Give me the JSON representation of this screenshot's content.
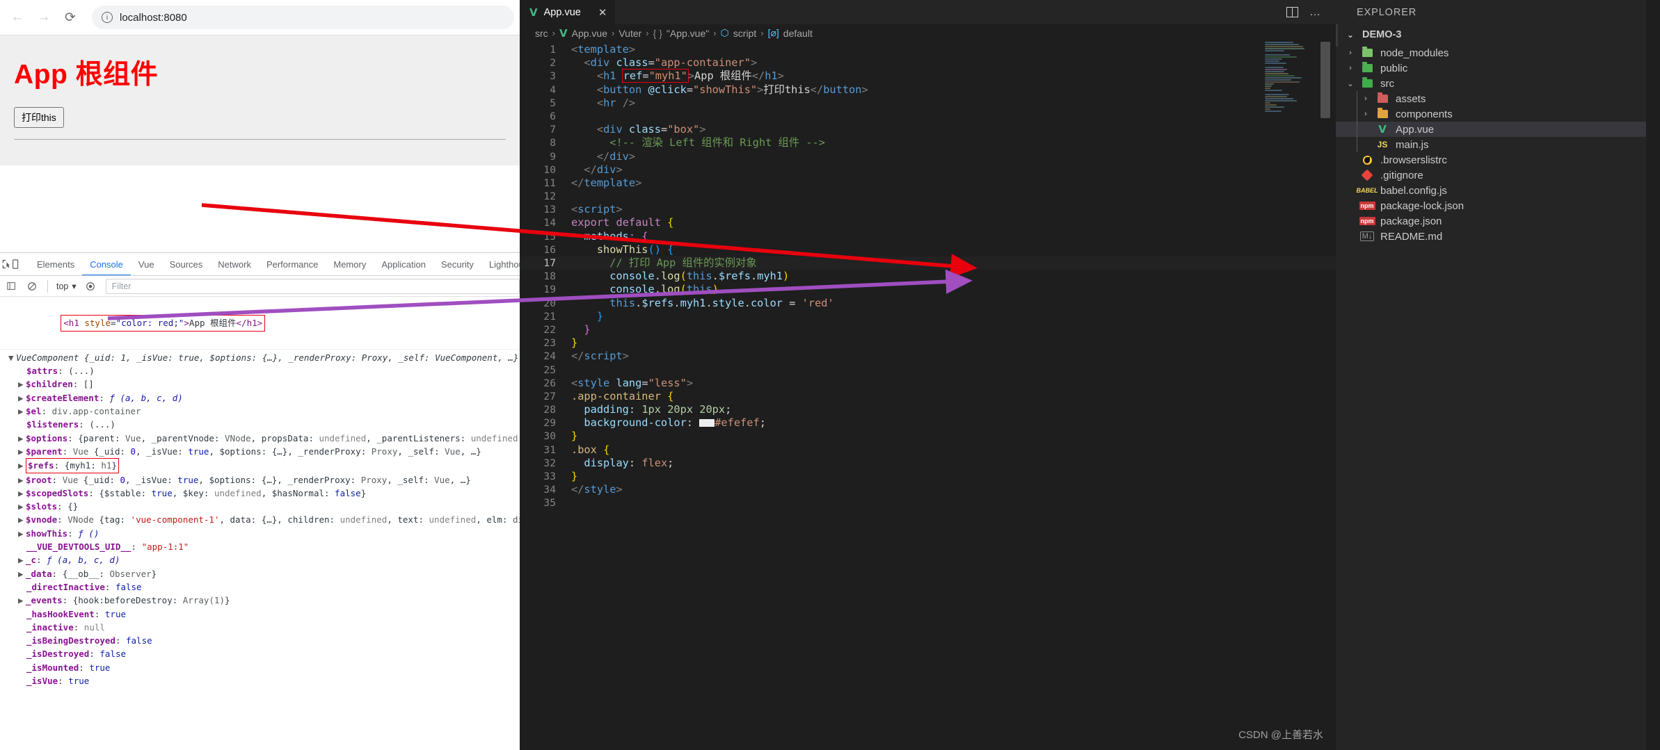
{
  "browser": {
    "nav": {
      "back": "←",
      "forward": "→",
      "reload": "⟳"
    },
    "url": "localhost:8080",
    "page": {
      "heading": "App 根组件",
      "button": "打印this"
    }
  },
  "devtools": {
    "tabs": [
      {
        "label": "Elements",
        "active": false
      },
      {
        "label": "Console",
        "active": true
      },
      {
        "label": "Vue",
        "active": false
      },
      {
        "label": "Sources",
        "active": false
      },
      {
        "label": "Network",
        "active": false
      },
      {
        "label": "Performance",
        "active": false
      },
      {
        "label": "Memory",
        "active": false
      },
      {
        "label": "Application",
        "active": false
      },
      {
        "label": "Security",
        "active": false
      },
      {
        "label": "Lighthouse",
        "active": false
      }
    ],
    "context": "top",
    "filter_placeholder": "Filter",
    "logged_element": "<h1 style=\"color: red;\">App 根组件</h1>",
    "object": {
      "header": "VueComponent {_uid: 1, _isVue: true, $options: {…}, _renderProxy: Proxy, _self: VueComponent, …}",
      "rows": [
        "$attrs: (...)",
        "$children: []",
        "$createElement: ƒ (a, b, c, d)",
        "$el: div.app-container",
        "$listeners: (...)",
        "$options: {parent: Vue, _parentVnode: VNode, propsData: undefined, _parentListeners: undefined, _renderChildr",
        "$parent: Vue {_uid: 0, _isVue: true, $options: {…}, _renderProxy: Proxy, _self: Vue, …}",
        "$refs: {myh1: h1}",
        "$root: Vue {_uid: 0, _isVue: true, $options: {…}, _renderProxy: Proxy, _self: Vue, …}",
        "$scopedSlots: {$stable: true, $key: undefined, $hasNormal: false}",
        "$slots: {}",
        "$vnode: VNode {tag: 'vue-component-1', data: {…}, children: undefined, text: undefined, elm: div.app-container",
        "showThis: ƒ ()",
        "__VUE_DEVTOOLS_UID__: \"app-1:1\"",
        "_c: ƒ (a, b, c, d)",
        "_data: {__ob__: Observer}",
        "_directInactive: false",
        "_events: {hook:beforeDestroy: Array(1)}",
        "_hasHookEvent: true",
        "_inactive: null",
        "_isBeingDestroyed: false",
        "_isDestroyed: false",
        "_isMounted: true",
        "_isVue: true"
      ]
    }
  },
  "vscode": {
    "tab": {
      "label": "App.vue",
      "icon": "vue-icon",
      "close": "✕"
    },
    "tabbar_actions": {
      "split": "split-editor-icon",
      "more": "…"
    },
    "breadcrumb": [
      "src",
      "App.vue",
      "Vuter",
      "\"App.vue\"",
      "script",
      "default"
    ],
    "code": [
      {
        "n": "1",
        "html": "<span class='k-brk'>&lt;</span><span class='k-tagname'>template</span><span class='k-brk'>&gt;</span>"
      },
      {
        "n": "2",
        "html": "  <span class='k-brk'>&lt;</span><span class='k-tagname'>div</span> <span class='k-attr'>class</span><span class='k-txt'>=</span><span class='k-str'>\"app-container\"</span><span class='k-brk'>&gt;</span>"
      },
      {
        "n": "3",
        "html": "    <span class='k-brk'>&lt;</span><span class='k-tagname'>h1</span> <span class='hl-code'><span class='k-attr'>ref</span><span class='k-txt'>=</span><span class='k-str'>\"myh1\"</span></span><span class='k-brk'>&gt;</span><span class='k-txt'>App 根组件</span><span class='k-brk'>&lt;/</span><span class='k-tagname'>h1</span><span class='k-brk'>&gt;</span>"
      },
      {
        "n": "4",
        "html": "    <span class='k-brk'>&lt;</span><span class='k-tagname'>button</span> <span class='k-attr'>@click</span><span class='k-txt'>=</span><span class='k-str'>\"showThis\"</span><span class='k-brk'>&gt;</span><span class='k-txt'>打印this</span><span class='k-brk'>&lt;/</span><span class='k-tagname'>button</span><span class='k-brk'>&gt;</span>"
      },
      {
        "n": "5",
        "html": "    <span class='k-brk'>&lt;</span><span class='k-tagname'>hr</span> <span class='k-brk'>/&gt;</span>"
      },
      {
        "n": "6",
        "html": ""
      },
      {
        "n": "7",
        "html": "    <span class='k-brk'>&lt;</span><span class='k-tagname'>div</span> <span class='k-attr'>class</span><span class='k-txt'>=</span><span class='k-str'>\"box\"</span><span class='k-brk'>&gt;</span>"
      },
      {
        "n": "8",
        "html": "      <span class='k-cmt'>&lt;!-- 渲染 Left 组件和 Right 组件 --&gt;</span>"
      },
      {
        "n": "9",
        "html": "    <span class='k-brk'>&lt;/</span><span class='k-tagname'>div</span><span class='k-brk'>&gt;</span>"
      },
      {
        "n": "10",
        "html": "  <span class='k-brk'>&lt;/</span><span class='k-tagname'>div</span><span class='k-brk'>&gt;</span>"
      },
      {
        "n": "11",
        "html": "<span class='k-brk'>&lt;/</span><span class='k-tagname'>template</span><span class='k-brk'>&gt;</span>"
      },
      {
        "n": "12",
        "html": ""
      },
      {
        "n": "13",
        "html": "<span class='k-brk'>&lt;</span><span class='k-tagname'>script</span><span class='k-brk'>&gt;</span>"
      },
      {
        "n": "14",
        "html": "<span class='k-kw'>export</span> <span class='k-kw'>default</span> <span class='k-y'>{</span>"
      },
      {
        "n": "15",
        "html": "  <span class='k-var'>methods</span><span class='k-p'>:</span> <span class='k-p'>{</span>"
      },
      {
        "n": "16",
        "html": "    <span class='k-fn'>showThis</span><span class='k-b'>()</span> <span class='k-b'>{</span>"
      },
      {
        "n": "17",
        "html": "      <span class='k-cmt'>// 打印 App 组件的实例对象</span>",
        "current": true
      },
      {
        "n": "18",
        "html": "      <span class='k-var'>console</span><span class='k-txt'>.</span><span class='k-fn'>log</span><span class='k-y'>(</span><span class='k-blue'>this</span><span class='k-txt'>.</span><span class='k-var'>$refs</span><span class='k-txt'>.</span><span class='k-var'>myh1</span><span class='k-y'>)</span>"
      },
      {
        "n": "19",
        "html": "      <span class='k-var'>console</span><span class='k-txt'>.</span><span class='k-fn'>log</span><span class='k-y'>(</span><span class='k-blue'>this</span><span class='k-y'>)</span>"
      },
      {
        "n": "20",
        "html": "      <span class='k-blue'>this</span><span class='k-txt'>.</span><span class='k-var'>$refs</span><span class='k-txt'>.</span><span class='k-var'>myh1</span><span class='k-txt'>.</span><span class='k-var'>style</span><span class='k-txt'>.</span><span class='k-var'>color</span> <span class='k-txt'>=</span> <span class='k-str'>'red'</span>"
      },
      {
        "n": "21",
        "html": "    <span class='k-b'>}</span>"
      },
      {
        "n": "22",
        "html": "  <span class='k-p'>}</span>"
      },
      {
        "n": "23",
        "html": "<span class='k-y'>}</span>"
      },
      {
        "n": "24",
        "html": "<span class='k-brk'>&lt;/</span><span class='k-tagname'>script</span><span class='k-brk'>&gt;</span>"
      },
      {
        "n": "25",
        "html": ""
      },
      {
        "n": "26",
        "html": "<span class='k-brk'>&lt;</span><span class='k-tagname'>style</span> <span class='k-attr'>lang</span><span class='k-txt'>=</span><span class='k-str'>\"less\"</span><span class='k-brk'>&gt;</span>"
      },
      {
        "n": "27",
        "html": "<span class='k-css-sel'>.app-container</span> <span class='k-y'>{</span>"
      },
      {
        "n": "28",
        "html": "  <span class='k-css-prop'>padding</span><span class='k-txt'>:</span> <span class='k-num'>1px</span> <span class='k-num'>20px</span> <span class='k-num'>20px</span><span class='k-txt'>;</span>"
      },
      {
        "n": "29",
        "html": "  <span class='k-css-prop'>background-color</span><span class='k-txt'>:</span> <span class='colorchip'></span><span class='colorchip'></span><span class='k-str'>#efefef</span><span class='k-txt'>;</span>"
      },
      {
        "n": "30",
        "html": "<span class='k-y'>}</span>"
      },
      {
        "n": "31",
        "html": "<span class='k-css-sel'>.box</span> <span class='k-y'>{</span>"
      },
      {
        "n": "32",
        "html": "  <span class='k-css-prop'>display</span><span class='k-txt'>:</span> <span class='k-str'>flex</span><span class='k-txt'>;</span>"
      },
      {
        "n": "33",
        "html": "<span class='k-y'>}</span>"
      },
      {
        "n": "34",
        "html": "<span class='k-brk'>&lt;/</span><span class='k-tagname'>style</span><span class='k-brk'>&gt;</span>"
      },
      {
        "n": "35",
        "html": ""
      }
    ],
    "watermark": "CSDN @上善若水"
  },
  "explorer": {
    "title": "EXPLORER",
    "root": {
      "label": "DEMO-3",
      "expanded": true
    },
    "items": [
      {
        "label": "node_modules",
        "depth": 1,
        "type": "folder",
        "chev": "›",
        "color": "#7bc36a"
      },
      {
        "label": "public",
        "depth": 1,
        "type": "folder",
        "chev": "›",
        "color": "#4caf50"
      },
      {
        "label": "src",
        "depth": 1,
        "type": "folder",
        "chev": "⌄",
        "color": "#3fae4a"
      },
      {
        "label": "assets",
        "depth": 2,
        "type": "folder",
        "chev": "›",
        "color": "#d05c5c"
      },
      {
        "label": "components",
        "depth": 2,
        "type": "folder",
        "chev": "›",
        "color": "#e2a33c"
      },
      {
        "label": "App.vue",
        "depth": 2,
        "type": "vue",
        "chev": "",
        "selected": true
      },
      {
        "label": "main.js",
        "depth": 2,
        "type": "js",
        "chev": ""
      },
      {
        "label": ".browserslistrc",
        "depth": 1,
        "type": "browserslist",
        "chev": ""
      },
      {
        "label": ".gitignore",
        "depth": 1,
        "type": "git",
        "chev": ""
      },
      {
        "label": "babel.config.js",
        "depth": 1,
        "type": "babel",
        "chev": ""
      },
      {
        "label": "package-lock.json",
        "depth": 1,
        "type": "npm",
        "chev": ""
      },
      {
        "label": "package.json",
        "depth": 1,
        "type": "npm",
        "chev": ""
      },
      {
        "label": "README.md",
        "depth": 1,
        "type": "md",
        "chev": ""
      }
    ]
  },
  "annotations": {
    "red_arrow": {
      "color": "#e8000d",
      "from": "console-logged-element",
      "to": "code-line-18"
    },
    "purple_arrow": {
      "color": "#a04ec0",
      "from": "console-refs-row",
      "to": "code-line-19"
    }
  },
  "colors": {
    "accent_red": "#ff0000",
    "vue_green": "#41b883",
    "editor_bg": "#1e1e1e",
    "sidebar_bg": "#252526",
    "page_bg": "#efefef"
  }
}
